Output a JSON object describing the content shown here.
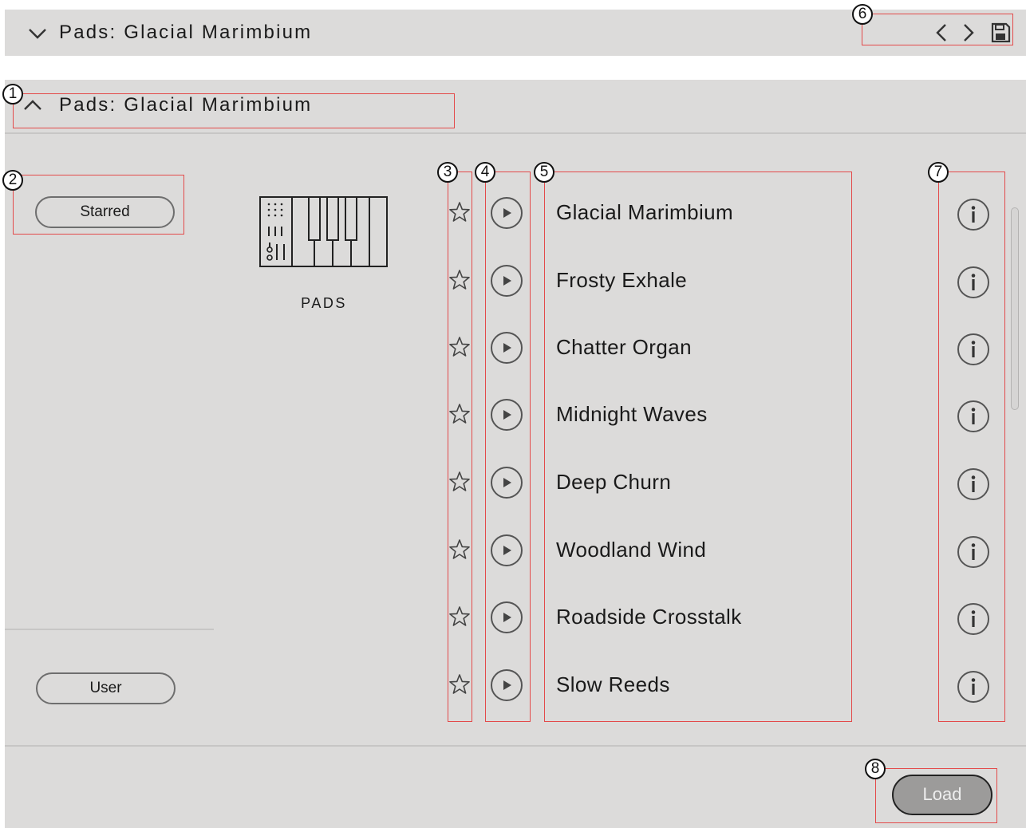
{
  "header": {
    "title": "Pads: Glacial Marimbium",
    "expand_icon": "chevron-down-icon",
    "prev_icon": "chevron-left-icon",
    "next_icon": "chevron-right-icon",
    "save_icon": "floppy-disk-icon"
  },
  "browser": {
    "title": "Pads: Glacial Marimbium",
    "collapse_icon": "chevron-up-icon",
    "filters": {
      "starred_label": "Starred",
      "user_label": "User"
    },
    "category": {
      "label": "PADS",
      "icon": "keyboard-synth-icon"
    },
    "presets": [
      {
        "name": "Glacial Marimbium"
      },
      {
        "name": "Frosty Exhale"
      },
      {
        "name": "Chatter Organ"
      },
      {
        "name": "Midnight Waves"
      },
      {
        "name": "Deep Churn"
      },
      {
        "name": "Woodland Wind"
      },
      {
        "name": "Roadside Crosstalk"
      },
      {
        "name": "Slow Reeds"
      }
    ],
    "row_icons": {
      "star": "star-outline-icon",
      "play": "play-circle-icon",
      "info": "info-circle-icon"
    },
    "load_label": "Load"
  },
  "callouts": [
    "1",
    "2",
    "3",
    "4",
    "5",
    "6",
    "7",
    "8"
  ],
  "colors": {
    "panel": "#dcdbda",
    "callout": "#e34a4a",
    "load_button": "#9c9b9a"
  }
}
